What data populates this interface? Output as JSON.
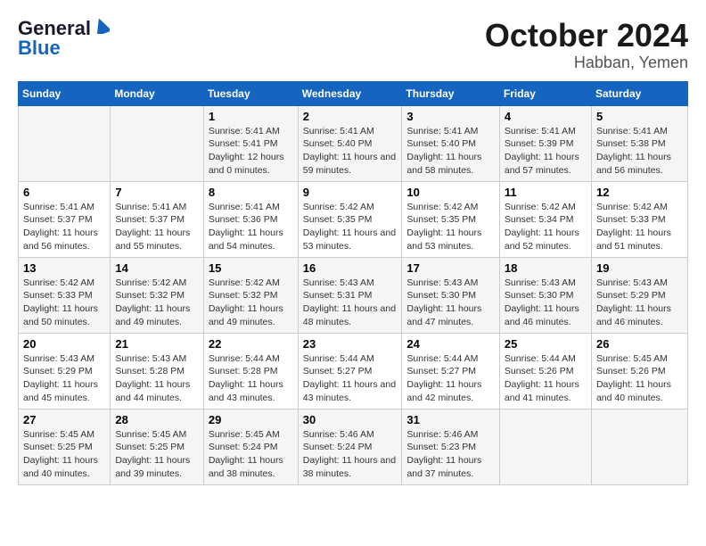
{
  "logo": {
    "general": "General",
    "blue": "Blue"
  },
  "title": "October 2024",
  "location": "Habban, Yemen",
  "days_of_week": [
    "Sunday",
    "Monday",
    "Tuesday",
    "Wednesday",
    "Thursday",
    "Friday",
    "Saturday"
  ],
  "weeks": [
    [
      {
        "day": "",
        "info": ""
      },
      {
        "day": "",
        "info": ""
      },
      {
        "day": "1",
        "info": "Sunrise: 5:41 AM\nSunset: 5:41 PM\nDaylight: 12 hours and 0 minutes."
      },
      {
        "day": "2",
        "info": "Sunrise: 5:41 AM\nSunset: 5:40 PM\nDaylight: 11 hours and 59 minutes."
      },
      {
        "day": "3",
        "info": "Sunrise: 5:41 AM\nSunset: 5:40 PM\nDaylight: 11 hours and 58 minutes."
      },
      {
        "day": "4",
        "info": "Sunrise: 5:41 AM\nSunset: 5:39 PM\nDaylight: 11 hours and 57 minutes."
      },
      {
        "day": "5",
        "info": "Sunrise: 5:41 AM\nSunset: 5:38 PM\nDaylight: 11 hours and 56 minutes."
      }
    ],
    [
      {
        "day": "6",
        "info": "Sunrise: 5:41 AM\nSunset: 5:37 PM\nDaylight: 11 hours and 56 minutes."
      },
      {
        "day": "7",
        "info": "Sunrise: 5:41 AM\nSunset: 5:37 PM\nDaylight: 11 hours and 55 minutes."
      },
      {
        "day": "8",
        "info": "Sunrise: 5:41 AM\nSunset: 5:36 PM\nDaylight: 11 hours and 54 minutes."
      },
      {
        "day": "9",
        "info": "Sunrise: 5:42 AM\nSunset: 5:35 PM\nDaylight: 11 hours and 53 minutes."
      },
      {
        "day": "10",
        "info": "Sunrise: 5:42 AM\nSunset: 5:35 PM\nDaylight: 11 hours and 53 minutes."
      },
      {
        "day": "11",
        "info": "Sunrise: 5:42 AM\nSunset: 5:34 PM\nDaylight: 11 hours and 52 minutes."
      },
      {
        "day": "12",
        "info": "Sunrise: 5:42 AM\nSunset: 5:33 PM\nDaylight: 11 hours and 51 minutes."
      }
    ],
    [
      {
        "day": "13",
        "info": "Sunrise: 5:42 AM\nSunset: 5:33 PM\nDaylight: 11 hours and 50 minutes."
      },
      {
        "day": "14",
        "info": "Sunrise: 5:42 AM\nSunset: 5:32 PM\nDaylight: 11 hours and 49 minutes."
      },
      {
        "day": "15",
        "info": "Sunrise: 5:42 AM\nSunset: 5:32 PM\nDaylight: 11 hours and 49 minutes."
      },
      {
        "day": "16",
        "info": "Sunrise: 5:43 AM\nSunset: 5:31 PM\nDaylight: 11 hours and 48 minutes."
      },
      {
        "day": "17",
        "info": "Sunrise: 5:43 AM\nSunset: 5:30 PM\nDaylight: 11 hours and 47 minutes."
      },
      {
        "day": "18",
        "info": "Sunrise: 5:43 AM\nSunset: 5:30 PM\nDaylight: 11 hours and 46 minutes."
      },
      {
        "day": "19",
        "info": "Sunrise: 5:43 AM\nSunset: 5:29 PM\nDaylight: 11 hours and 46 minutes."
      }
    ],
    [
      {
        "day": "20",
        "info": "Sunrise: 5:43 AM\nSunset: 5:29 PM\nDaylight: 11 hours and 45 minutes."
      },
      {
        "day": "21",
        "info": "Sunrise: 5:43 AM\nSunset: 5:28 PM\nDaylight: 11 hours and 44 minutes."
      },
      {
        "day": "22",
        "info": "Sunrise: 5:44 AM\nSunset: 5:28 PM\nDaylight: 11 hours and 43 minutes."
      },
      {
        "day": "23",
        "info": "Sunrise: 5:44 AM\nSunset: 5:27 PM\nDaylight: 11 hours and 43 minutes."
      },
      {
        "day": "24",
        "info": "Sunrise: 5:44 AM\nSunset: 5:27 PM\nDaylight: 11 hours and 42 minutes."
      },
      {
        "day": "25",
        "info": "Sunrise: 5:44 AM\nSunset: 5:26 PM\nDaylight: 11 hours and 41 minutes."
      },
      {
        "day": "26",
        "info": "Sunrise: 5:45 AM\nSunset: 5:26 PM\nDaylight: 11 hours and 40 minutes."
      }
    ],
    [
      {
        "day": "27",
        "info": "Sunrise: 5:45 AM\nSunset: 5:25 PM\nDaylight: 11 hours and 40 minutes."
      },
      {
        "day": "28",
        "info": "Sunrise: 5:45 AM\nSunset: 5:25 PM\nDaylight: 11 hours and 39 minutes."
      },
      {
        "day": "29",
        "info": "Sunrise: 5:45 AM\nSunset: 5:24 PM\nDaylight: 11 hours and 38 minutes."
      },
      {
        "day": "30",
        "info": "Sunrise: 5:46 AM\nSunset: 5:24 PM\nDaylight: 11 hours and 38 minutes."
      },
      {
        "day": "31",
        "info": "Sunrise: 5:46 AM\nSunset: 5:23 PM\nDaylight: 11 hours and 37 minutes."
      },
      {
        "day": "",
        "info": ""
      },
      {
        "day": "",
        "info": ""
      }
    ]
  ]
}
